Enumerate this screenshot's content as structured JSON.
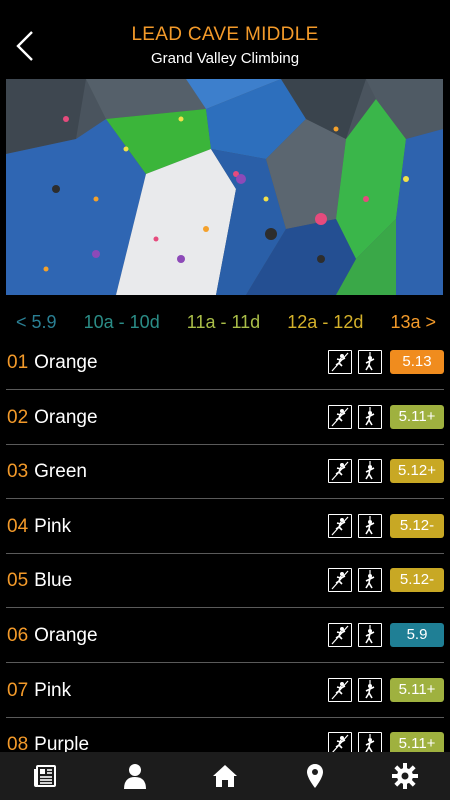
{
  "header": {
    "title": "LEAD CAVE MIDDLE",
    "subtitle": "Grand Valley Climbing",
    "back_icon": "chevron-left-icon"
  },
  "wall_photo": {
    "alt": "climbing-wall-photo"
  },
  "grade_tabs": [
    {
      "label": "< 5.9",
      "color": "#2a7f93"
    },
    {
      "label": "10a - 10d",
      "color": "#2b8d87"
    },
    {
      "label": "11a - 11d",
      "color": "#a9bd48"
    },
    {
      "label": "12a - 12d",
      "color": "#d4b12b"
    },
    {
      "label": "13a >",
      "color": "#f39a2a"
    }
  ],
  "routes": [
    {
      "number": "01",
      "color_name": "Orange",
      "grade": "5.13",
      "grade_color": "#f08c1e"
    },
    {
      "number": "02",
      "color_name": "Orange",
      "grade": "5.11+",
      "grade_color": "#9fb13f"
    },
    {
      "number": "03",
      "color_name": "Green",
      "grade": "5.12+",
      "grade_color": "#c8a824"
    },
    {
      "number": "04",
      "color_name": "Pink",
      "grade": "5.12-",
      "grade_color": "#c8a824"
    },
    {
      "number": "05",
      "color_name": "Blue",
      "grade": "5.12-",
      "grade_color": "#c8a824"
    },
    {
      "number": "06",
      "color_name": "Orange",
      "grade": "5.9",
      "grade_color": "#1f7f95"
    },
    {
      "number": "07",
      "color_name": "Pink",
      "grade": "5.11+",
      "grade_color": "#9fb13f"
    },
    {
      "number": "08",
      "color_name": "Purple",
      "grade": "5.11+",
      "grade_color": "#9fb13f"
    }
  ],
  "route_icons": {
    "lead": "lead-climber-icon",
    "toprope": "toprope-climber-icon"
  },
  "tabbar": [
    {
      "name": "news-icon"
    },
    {
      "name": "profile-icon"
    },
    {
      "name": "home-icon"
    },
    {
      "name": "location-icon"
    },
    {
      "name": "settings-icon"
    }
  ],
  "colors": {
    "accent": "#f39a2a",
    "background": "#000000",
    "tabbar": "#1c1c1c"
  }
}
